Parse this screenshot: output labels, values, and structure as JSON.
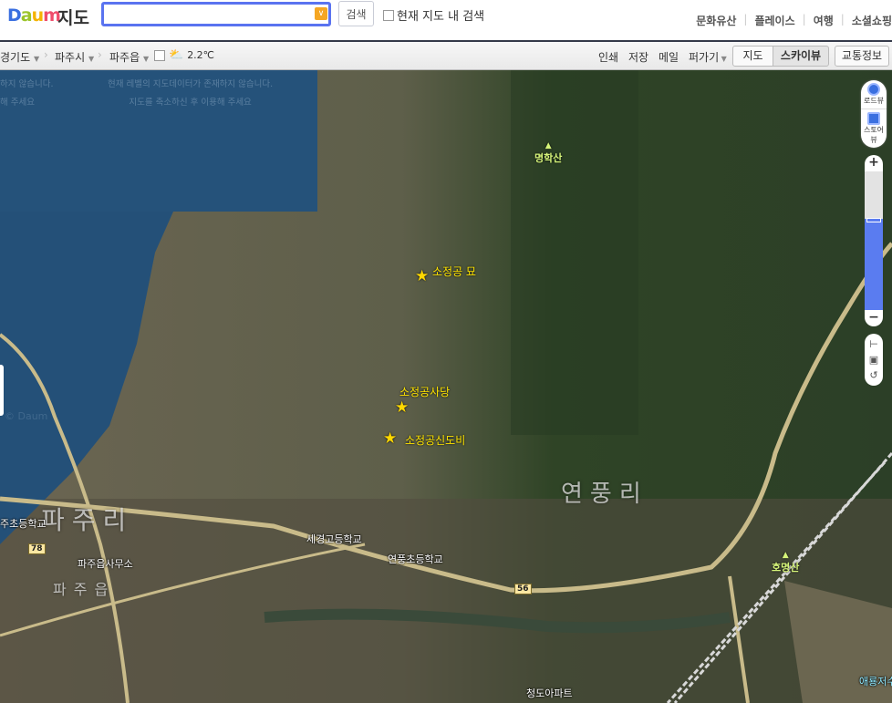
{
  "header": {
    "logo": {
      "d": "D",
      "a": "a",
      "u": "u",
      "m": "m"
    },
    "title": "지도",
    "search": {
      "value": "",
      "placeholder": ""
    },
    "search_button": "검색",
    "in_map_search": "현재 지도 내 검색",
    "gnb": [
      "문화유산",
      "플레이스",
      "여행",
      "소셜쇼핑"
    ]
  },
  "toolbar": {
    "breadcrumb": [
      {
        "label": "경기도"
      },
      {
        "label": "파주시"
      },
      {
        "label": "파주읍"
      }
    ],
    "weather": {
      "icon": "partly-cloudy-icon",
      "temp": "2.2℃"
    },
    "links": [
      "인쇄",
      "저장",
      "메일"
    ],
    "edit": "퍼가기",
    "map_types": [
      "지도",
      "스카이뷰"
    ],
    "active_map_type": "스카이뷰",
    "traffic": "교통정보"
  },
  "map": {
    "nodata": [
      {
        "line1": "현재 레벨의 지도데이터가 존재하지 않습니다.",
        "line2": "지도를 축소하신 후 이용해 주세요"
      },
      {
        "line1": "하지 않습니다.",
        "line2": "해 주세요"
      }
    ],
    "pois": [
      {
        "label": "소정공 묘"
      },
      {
        "label": "소정공사당"
      },
      {
        "label": "소정공신도비"
      }
    ],
    "mountains": [
      "명학산",
      "호명산"
    ],
    "areas": [
      "연풍리",
      "파주리",
      "파주읍"
    ],
    "labels": [
      "세경고등학교",
      "연풍초등학교",
      "파주읍사무소",
      "주초등학교",
      "청도아파트",
      "애룡저수"
    ],
    "routes": [
      "78",
      "56"
    ],
    "watermark": "© Daum"
  },
  "controls": {
    "roadview": "로드뷰",
    "storeview": "스토어뷰",
    "zoom_in": "+",
    "zoom_out": "−",
    "zoom_level_fraction": 0.66,
    "tools": [
      "ruler-icon",
      "area-icon",
      "reset-icon"
    ]
  }
}
